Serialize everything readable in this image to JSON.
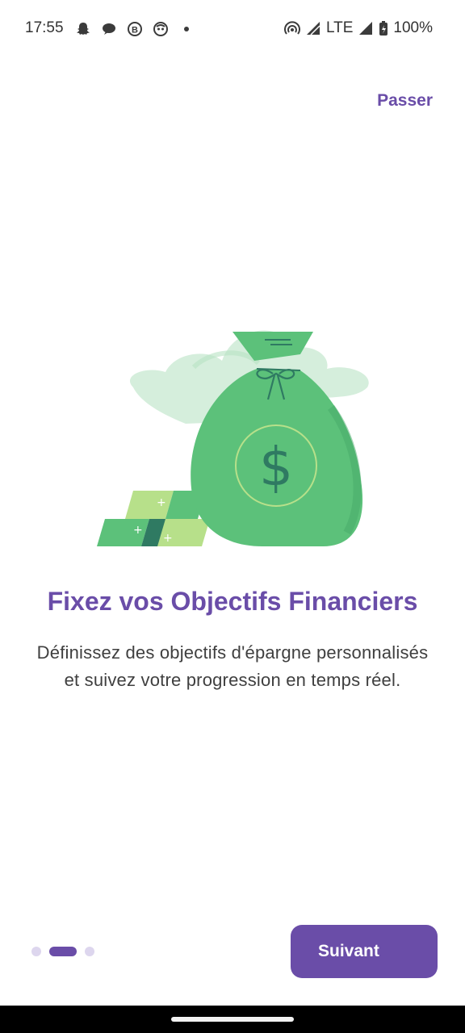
{
  "status_bar": {
    "time": "17:55",
    "notification_icons": [
      "snapchat-icon",
      "chat-bubble-icon",
      "b-circle-icon",
      "ghost-icon",
      "dot-icon"
    ],
    "network": "LTE",
    "battery": "100%"
  },
  "header": {
    "skip_label": "Passer"
  },
  "onboarding": {
    "illustration": "money-bag-icon",
    "title": "Fixez vos Objectifs Financiers",
    "description": "Définissez des objectifs d'épargne personnalisés et suivez votre progression en temps réel.",
    "page_count": 3,
    "current_page": 2
  },
  "footer": {
    "next_label": "Suivant"
  },
  "colors": {
    "accent": "#6a4da8",
    "dot_inactive": "#ddd6ee",
    "money_green": "#5cc17a",
    "money_green_light": "#b7e08a",
    "money_green_dark": "#2f7a62"
  }
}
